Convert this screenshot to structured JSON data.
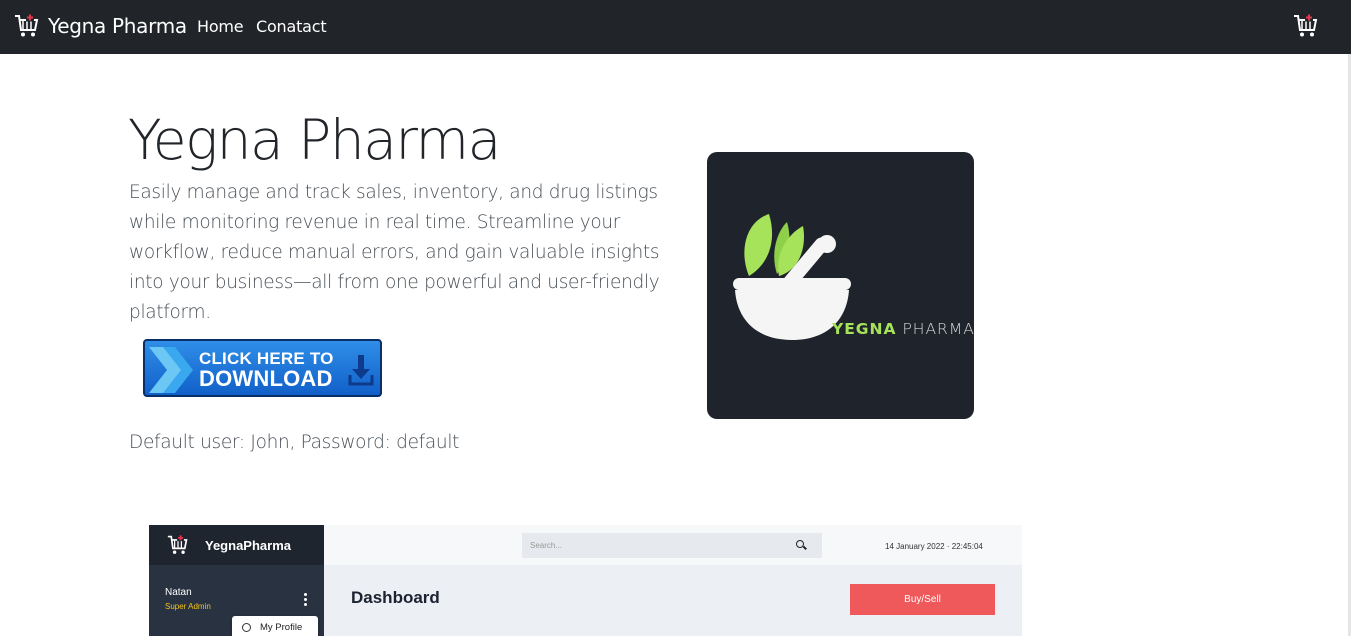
{
  "navbar": {
    "brand": "Yegna Pharma",
    "links": [
      "Home",
      "Conatact"
    ],
    "cart_icon": "cart-icon"
  },
  "hero": {
    "title": "Yegna Pharma",
    "description": "Easily manage and track sales, inventory, and drug listings while monitoring revenue in real time. Streamline your workflow, reduce manual errors, and gain valuable insights into your business—all from one powerful and user-friendly platform.",
    "download": {
      "line1": "CLICK HERE TO",
      "line2": "DOWNLOAD"
    },
    "default_user": "Default user: John, Password: default"
  },
  "logo": {
    "word1": "YEGNA",
    "word2": " PHARMA"
  },
  "preview": {
    "brand": "YegnaPharma",
    "user": "Natan",
    "role": "Super Admin",
    "menu_item": "My Profile",
    "search_placeholder": "Search...",
    "datetime": "14 January 2022 · 22:45:04",
    "page_title": "Dashboard",
    "action_button": "Buy/Sell"
  },
  "colors": {
    "navbar": "#212529",
    "logo_bg": "#1f242c",
    "leaf_green": "#a6e35a",
    "download_blue": "#1a6fd8",
    "buy_red": "#f0595b"
  }
}
